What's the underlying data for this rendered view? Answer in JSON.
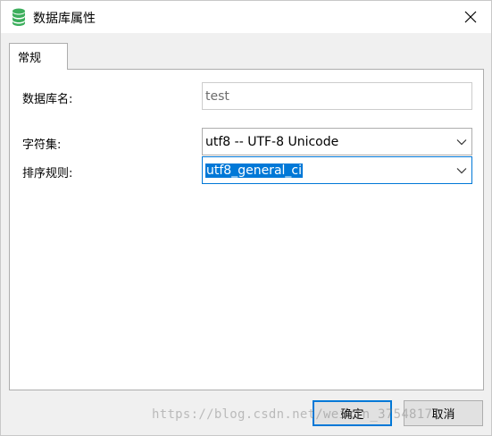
{
  "window": {
    "title": "数据库属性",
    "icon": "database-icon",
    "close_glyph": "✕"
  },
  "tabs": [
    {
      "label": "常规",
      "active": true
    }
  ],
  "form": {
    "db_name": {
      "label": "数据库名:",
      "value": "test",
      "enabled": false
    },
    "charset": {
      "label": "字符集:",
      "value": "utf8 -- UTF-8 Unicode"
    },
    "collation": {
      "label": "排序规则:",
      "value": "utf8_general_ci",
      "selected": true
    }
  },
  "buttons": {
    "ok": "确定",
    "cancel": "取消"
  },
  "watermark": "https://blog.csdn.net/weixin_37548171",
  "colors": {
    "accent": "#0078d7",
    "db_icon": "#3cae5c",
    "disabled_text": "#6d6d6d"
  }
}
